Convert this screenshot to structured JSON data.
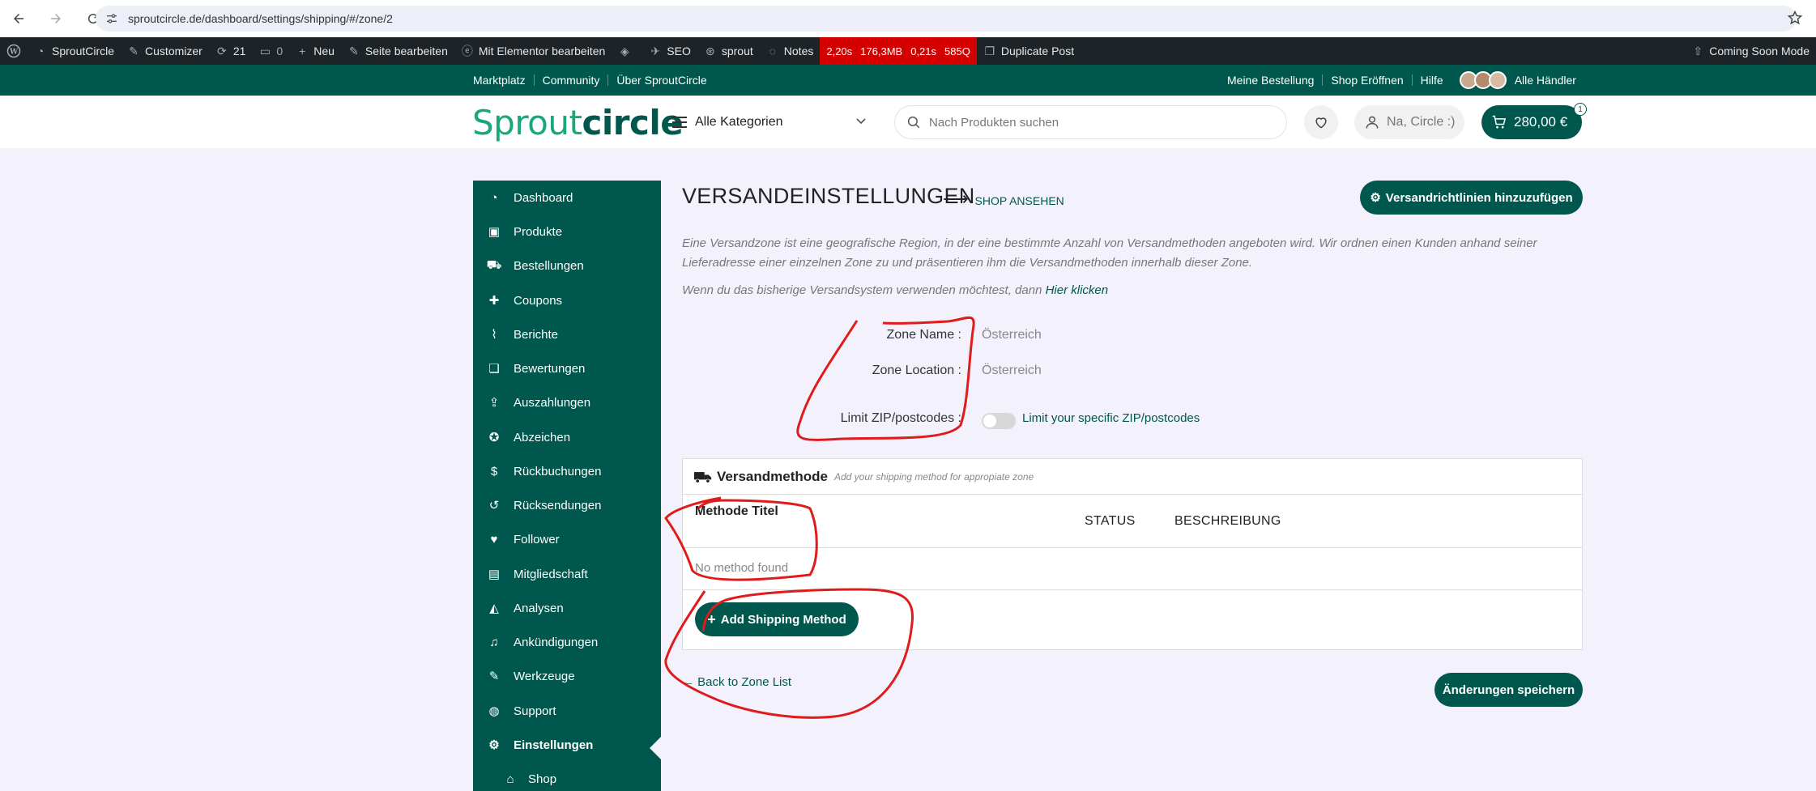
{
  "browser": {
    "url": "sproutcircle.de/dashboard/settings/shipping/#/zone/2"
  },
  "wp_admin_bar": {
    "site_name": "SproutCircle",
    "customizer": "Customizer",
    "updates_count": "21",
    "comments_count": "0",
    "new_label": "Neu",
    "edit_page": "Seite bearbeiten",
    "elementor": "Mit Elementor bearbeiten",
    "seo": "SEO",
    "sprout": "sprout",
    "notes": "Notes",
    "perf_time": "2,20s",
    "perf_mem": "176,3MB",
    "perf_db_time": "0,21s",
    "perf_queries": "585Q",
    "duplicate_post": "Duplicate Post",
    "coming_soon": "Coming Soon Mode"
  },
  "top_bar": {
    "left_links": [
      "Marktplatz",
      "Community",
      "Über SproutCircle"
    ],
    "right_links": [
      "Meine Bestellung",
      "Shop Eröffnen",
      "Hilfe"
    ],
    "all_vendors": "Alle Händler"
  },
  "header": {
    "logo_light": "Sprout",
    "logo_bold": "circle",
    "categories_label": "Alle Kategorien",
    "search_placeholder": "Nach Produkten suchen",
    "account_label": "Na, Circle :)",
    "cart_total": "280,00 €",
    "cart_count": "1"
  },
  "sidebar": {
    "items": [
      {
        "label": "Dashboard",
        "icon": "dashboard-icon"
      },
      {
        "label": "Produkte",
        "icon": "briefcase-icon"
      },
      {
        "label": "Bestellungen",
        "icon": "cart-icon"
      },
      {
        "label": "Coupons",
        "icon": "gift-icon"
      },
      {
        "label": "Berichte",
        "icon": "chart-line-icon"
      },
      {
        "label": "Bewertungen",
        "icon": "comments-icon"
      },
      {
        "label": "Auszahlungen",
        "icon": "upload-icon"
      },
      {
        "label": "Abzeichen",
        "icon": "award-icon"
      },
      {
        "label": "Rückbuchungen",
        "icon": "dollar-icon"
      },
      {
        "label": "Rücksendungen",
        "icon": "undo-icon"
      },
      {
        "label": "Follower",
        "icon": "heart-icon"
      },
      {
        "label": "Mitgliedschaft",
        "icon": "id-card-icon"
      },
      {
        "label": "Analysen",
        "icon": "area-chart-icon"
      },
      {
        "label": "Ankündigungen",
        "icon": "bell-icon"
      },
      {
        "label": "Werkzeuge",
        "icon": "wrench-icon"
      },
      {
        "label": "Support",
        "icon": "globe-icon"
      },
      {
        "label": "Einstellungen",
        "icon": "gear-icon"
      },
      {
        "label": "Shop",
        "icon": "bank-icon"
      }
    ]
  },
  "main": {
    "title": "VERSANDEINSTELLUNGEN",
    "shop_link": "SHOP ANSEHEN",
    "add_rule_button": "Versandrichtlinien hinzuzufügen",
    "description": "Eine Versandzone ist eine geografische Region, in der eine bestimmte Anzahl von Versandmethoden angeboten wird. Wir ordnen einen Kunden anhand seiner Lieferadresse einer einzelnen Zone zu und präsentieren ihm die Versandmethoden innerhalb dieser Zone.",
    "legacy_text": "Wenn du das bisherige Versandsystem verwenden möchtest, dann",
    "legacy_link": "Hier klicken",
    "zone_name_label": "Zone Name :",
    "zone_name_value": "Österreich",
    "zone_location_label": "Zone Location :",
    "zone_location_value": "Österreich",
    "limit_zip_label": "Limit ZIP/postcodes :",
    "limit_zip_toggle_text": "Limit your specific ZIP/postcodes",
    "shipping_method_title": "Versandmethode",
    "shipping_method_hint": "Add your shipping method for appropiate zone",
    "col_title": "Methode Titel",
    "col_status": "STATUS",
    "col_description": "BESCHREIBUNG",
    "empty_text": "No method found",
    "add_method_button": "Add Shipping Method",
    "back_link": "← Back to Zone List",
    "save_button": "Änderungen speichern"
  },
  "colors": {
    "brand_green": "#00574d",
    "logo_light_green": "#19a87e",
    "annotation_red": "#e01b1b",
    "perf_red": "#d40000"
  }
}
